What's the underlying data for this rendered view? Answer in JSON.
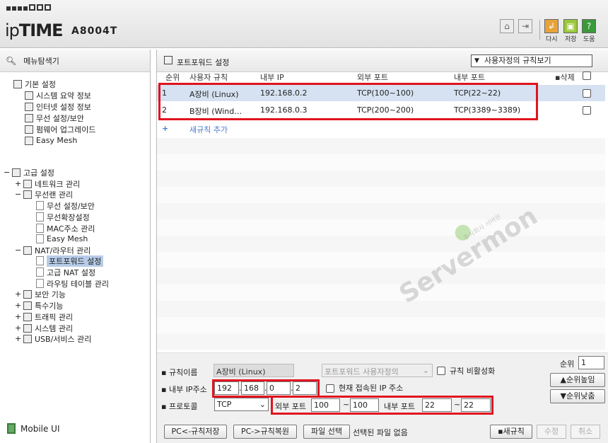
{
  "header": {
    "brand_prefix": "ip",
    "brand_bold": "TIME",
    "model": "A8004T",
    "toolbar": {
      "home": "⌂",
      "logout": "⇥",
      "unread_label": "다시",
      "save_label": "저장",
      "help_label": "도움",
      "help_glyph": "?"
    }
  },
  "sidebar": {
    "title": "메뉴탐색기",
    "basic": {
      "label": "기본 설정",
      "items": [
        "시스템 요약 정보",
        "인터넷 설정 정보",
        "무선 설정/보안",
        "펌웨어 업그레이드",
        "Easy Mesh"
      ]
    },
    "advanced": {
      "label": "고급 설정",
      "network": "네트워크 관리",
      "wireless": "무선랜 관리",
      "wireless_items": [
        "무선 설정/보안",
        "무선확장설정",
        "MAC주소 관리",
        "Easy Mesh"
      ],
      "nat": "NAT/라우터 관리",
      "nat_items": [
        "포트포워드 설정",
        "고급 NAT 설정",
        "라우팅 테이블 관리"
      ],
      "others": [
        "보안 기능",
        "특수기능",
        "트래픽 관리",
        "시스템 관리",
        "USB/서비스 관리"
      ]
    },
    "mobile": "Mobile UI"
  },
  "main": {
    "title": "포트포워드 설정",
    "view_select": "사용자정의 규칙보기",
    "columns": {
      "order": "순위",
      "rule": "사용자 규칙",
      "internal_ip": "내부 IP",
      "external_port": "외부 포트",
      "internal_port": "내부 포트",
      "delete": "삭제"
    },
    "rows": [
      {
        "order": "1",
        "rule": "A장비 (Linux)",
        "ip": "192.168.0.2",
        "ext": "TCP(100~100)",
        "int": "TCP(22~22)"
      },
      {
        "order": "2",
        "rule": "B장비 (Wind…",
        "ip": "192.168.0.3",
        "ext": "TCP(200~200)",
        "int": "TCP(3389~3389)"
      }
    ],
    "add_rule": "새규칙 추가",
    "watermark": {
      "text": "Servermon",
      "sub": "주식회사 서버몬"
    }
  },
  "form": {
    "rule_name_label": "규칙이름",
    "rule_name": "A장비 (Linux)",
    "preset": "포트포워드 사용자정의",
    "disable_label": "규칙 비활성화",
    "ip_label": "내부 IP주소",
    "ip": [
      "192",
      "168",
      "0",
      "2"
    ],
    "current_ip_label": "현재 접속된 IP 주소",
    "proto_label": "프로토콜",
    "proto": "TCP",
    "ext_label": "외부 포트",
    "ext_from": "100",
    "ext_to": "100",
    "int_label": "내부 포트",
    "int_from": "22",
    "int_to": "22",
    "tilde": "~",
    "dot": ".",
    "order_label": "순위",
    "order": "1",
    "up": "순위높임",
    "down": "순위낮춤",
    "btn_save_pc": "PC<-규칙저장",
    "btn_restore_pc": "PC->규칙복원",
    "btn_file": "파일 선택",
    "file_status": "선택된 파일 없음",
    "btn_new": "새규칙",
    "btn_edit": "수정",
    "btn_cancel": "취소"
  }
}
